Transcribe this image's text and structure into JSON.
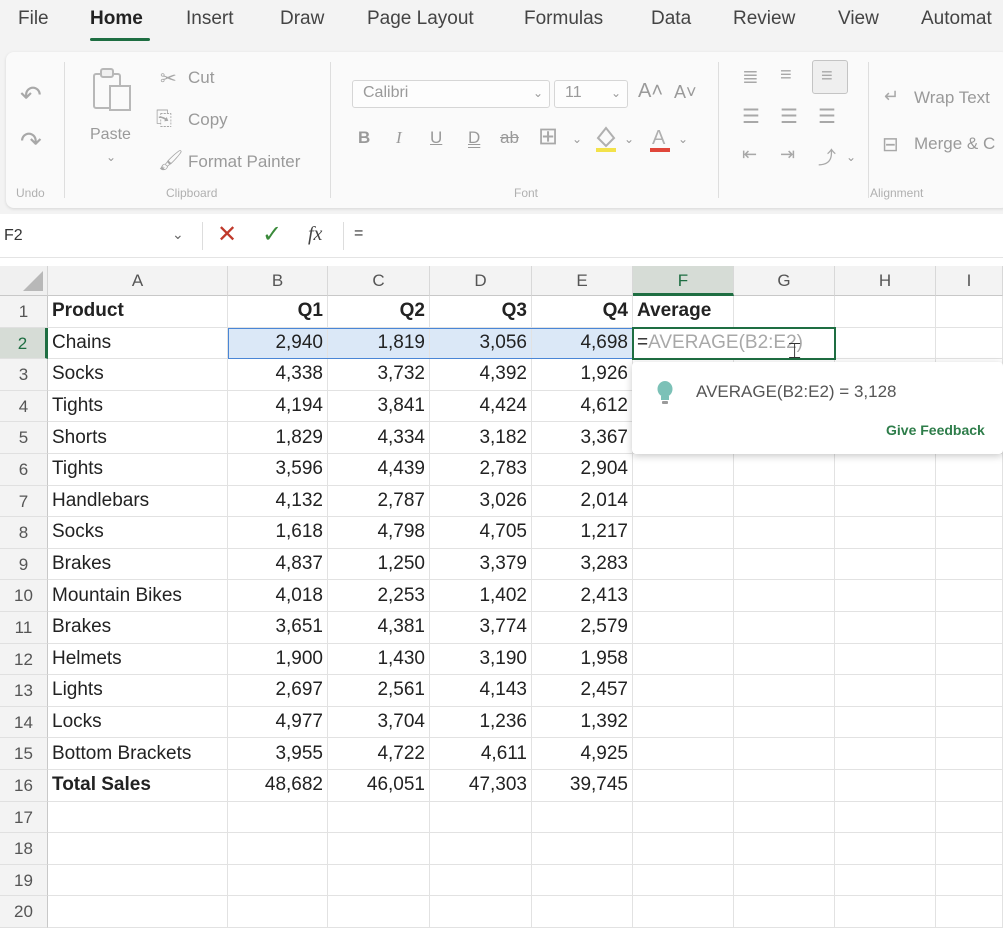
{
  "menu": {
    "tabs": [
      "File",
      "Home",
      "Insert",
      "Draw",
      "Page Layout",
      "Formulas",
      "Data",
      "Review",
      "View",
      "Automat"
    ],
    "active": "Home"
  },
  "ribbon": {
    "undo_group_label": "Undo",
    "clipboard": {
      "paste": "Paste",
      "cut": "Cut",
      "copy": "Copy",
      "format_painter": "Format Painter",
      "group_label": "Clipboard"
    },
    "font": {
      "font_name": "Calibri",
      "font_size": "11",
      "bold": "B",
      "italic": "I",
      "underline": "U",
      "double_underline": "D",
      "strike": "ab",
      "grow": "A˄",
      "shrink": "A˅",
      "group_label": "Font"
    },
    "alignment": {
      "wrap_text": "Wrap Text",
      "merge": "Merge & C",
      "group_label": "Alignment"
    }
  },
  "formula_bar": {
    "name_box": "F2",
    "formula": "="
  },
  "columns": [
    "A",
    "B",
    "C",
    "D",
    "E",
    "F",
    "G",
    "H",
    "I"
  ],
  "selected_column": "F",
  "selected_row": "2",
  "rows": [
    {
      "n": "1",
      "cells": [
        "Product",
        "Q1",
        "Q2",
        "Q3",
        "Q4",
        "Average"
      ]
    },
    {
      "n": "2",
      "cells": [
        "Chains",
        "2,940",
        "1,819",
        "3,056",
        "4,698",
        ""
      ]
    },
    {
      "n": "3",
      "cells": [
        "Socks",
        "4,338",
        "3,732",
        "4,392",
        "1,926",
        ""
      ]
    },
    {
      "n": "4",
      "cells": [
        "Tights",
        "4,194",
        "3,841",
        "4,424",
        "4,612",
        ""
      ]
    },
    {
      "n": "5",
      "cells": [
        "Shorts",
        "1,829",
        "4,334",
        "3,182",
        "3,367",
        ""
      ]
    },
    {
      "n": "6",
      "cells": [
        "Tights",
        "3,596",
        "4,439",
        "2,783",
        "2,904",
        ""
      ]
    },
    {
      "n": "7",
      "cells": [
        "Handlebars",
        "4,132",
        "2,787",
        "3,026",
        "2,014",
        ""
      ]
    },
    {
      "n": "8",
      "cells": [
        "Socks",
        "1,618",
        "4,798",
        "4,705",
        "1,217",
        ""
      ]
    },
    {
      "n": "9",
      "cells": [
        "Brakes",
        "4,837",
        "1,250",
        "3,379",
        "3,283",
        ""
      ]
    },
    {
      "n": "10",
      "cells": [
        "Mountain Bikes",
        "4,018",
        "2,253",
        "1,402",
        "2,413",
        ""
      ]
    },
    {
      "n": "11",
      "cells": [
        "Brakes",
        "3,651",
        "4,381",
        "3,774",
        "2,579",
        ""
      ]
    },
    {
      "n": "12",
      "cells": [
        "Helmets",
        "1,900",
        "1,430",
        "3,190",
        "1,958",
        ""
      ]
    },
    {
      "n": "13",
      "cells": [
        "Lights",
        "2,697",
        "2,561",
        "4,143",
        "2,457",
        ""
      ]
    },
    {
      "n": "14",
      "cells": [
        "Locks",
        "4,977",
        "3,704",
        "1,236",
        "1,392",
        ""
      ]
    },
    {
      "n": "15",
      "cells": [
        "Bottom Brackets",
        "3,955",
        "4,722",
        "4,611",
        "4,925",
        ""
      ]
    },
    {
      "n": "16",
      "cells": [
        "Total Sales",
        "48,682",
        "46,051",
        "47,303",
        "39,745",
        ""
      ]
    },
    {
      "n": "17",
      "cells": [
        "",
        "",
        "",
        "",
        "",
        ""
      ]
    },
    {
      "n": "18",
      "cells": [
        "",
        "",
        "",
        "",
        "",
        ""
      ]
    },
    {
      "n": "19",
      "cells": [
        "",
        "",
        "",
        "",
        "",
        ""
      ]
    },
    {
      "n": "20",
      "cells": [
        "",
        "",
        "",
        "",
        "",
        ""
      ]
    }
  ],
  "active_cell": {
    "typed": "=",
    "ghost": "AVERAGE(B2:E2)"
  },
  "suggestion": {
    "text": "AVERAGE(B2:E2)  =  3,128",
    "feedback": "Give Feedback"
  },
  "colors": {
    "accent": "#1e6e42",
    "selection": "#4a86d6",
    "selection_fill": "#dbe8f7",
    "cancel": "#c0392b"
  }
}
